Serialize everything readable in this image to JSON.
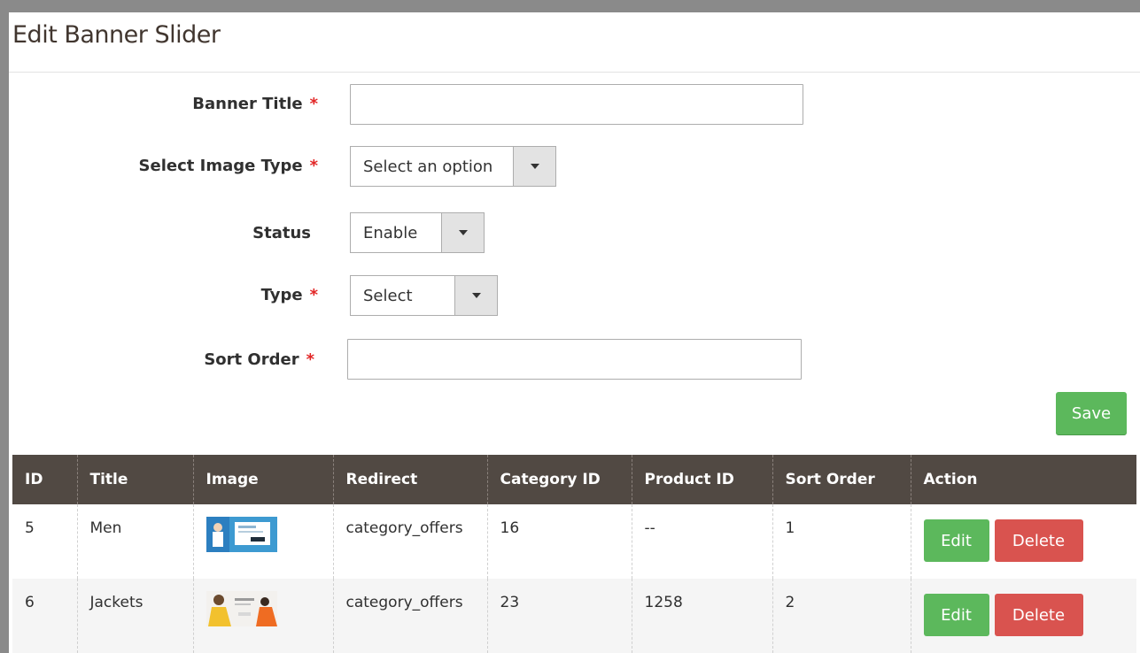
{
  "page": {
    "title": "Edit Banner Slider"
  },
  "form": {
    "banner_title": {
      "label": "Banner Title",
      "required_mark": "*",
      "value": ""
    },
    "image_type": {
      "label": "Select Image Type",
      "required_mark": "*",
      "value": "Select an option"
    },
    "status": {
      "label": "Status",
      "value": "Enable"
    },
    "type": {
      "label": "Type",
      "required_mark": "*",
      "value": "Select"
    },
    "sort_order": {
      "label": "Sort Order",
      "required_mark": "*",
      "value": ""
    },
    "save_label": "Save"
  },
  "table": {
    "headers": [
      "ID",
      "Title",
      "Image",
      "Redirect",
      "Category ID",
      "Product ID",
      "Sort Order",
      "Action"
    ],
    "rows": [
      {
        "id": "5",
        "title": "Men",
        "image_icon": "banner-thumbnail-men-icon",
        "redirect": "category_offers",
        "category_id": "16",
        "product_id": "--",
        "sort_order": "1",
        "edit_label": "Edit",
        "delete_label": "Delete"
      },
      {
        "id": "6",
        "title": "Jackets",
        "image_icon": "banner-thumbnail-jackets-icon",
        "redirect": "category_offers",
        "category_id": "23",
        "product_id": "1258",
        "sort_order": "2",
        "edit_label": "Edit",
        "delete_label": "Delete"
      }
    ]
  },
  "colors": {
    "header_bg": "#514943",
    "save_green": "#5cb85c",
    "delete_red": "#d9534f",
    "required_red": "#e22626"
  }
}
